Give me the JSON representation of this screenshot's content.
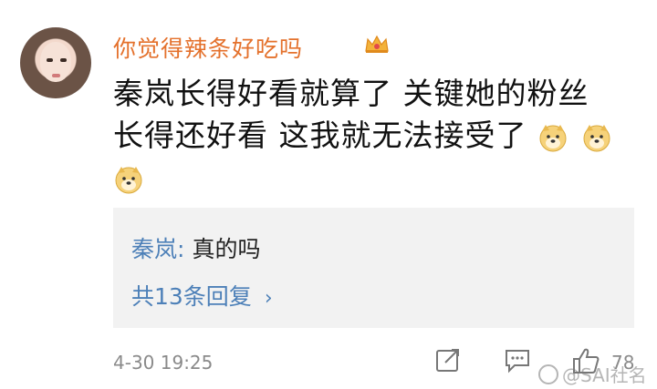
{
  "post": {
    "username": "你觉得辣条好吃吗",
    "badge_icon": "crown-icon",
    "comment_lines": [
      "秦岚长得好看就算了 关键她的粉丝",
      "长得还好看 这我就无法接受了"
    ],
    "emoji_icon": "doge-icon",
    "timestamp": "4-30 19:25",
    "like_count": "78"
  },
  "reply": {
    "author": "秦岚",
    "separator": ":",
    "text": "真的吗",
    "more_label": "共13条回复",
    "more_chevron": "›"
  },
  "watermark": {
    "text": "@SAI社名"
  },
  "colors": {
    "username": "#e4712c",
    "link": "#4d80b8",
    "reply_bg": "#f2f2f2",
    "meta": "#8a8a8a"
  }
}
